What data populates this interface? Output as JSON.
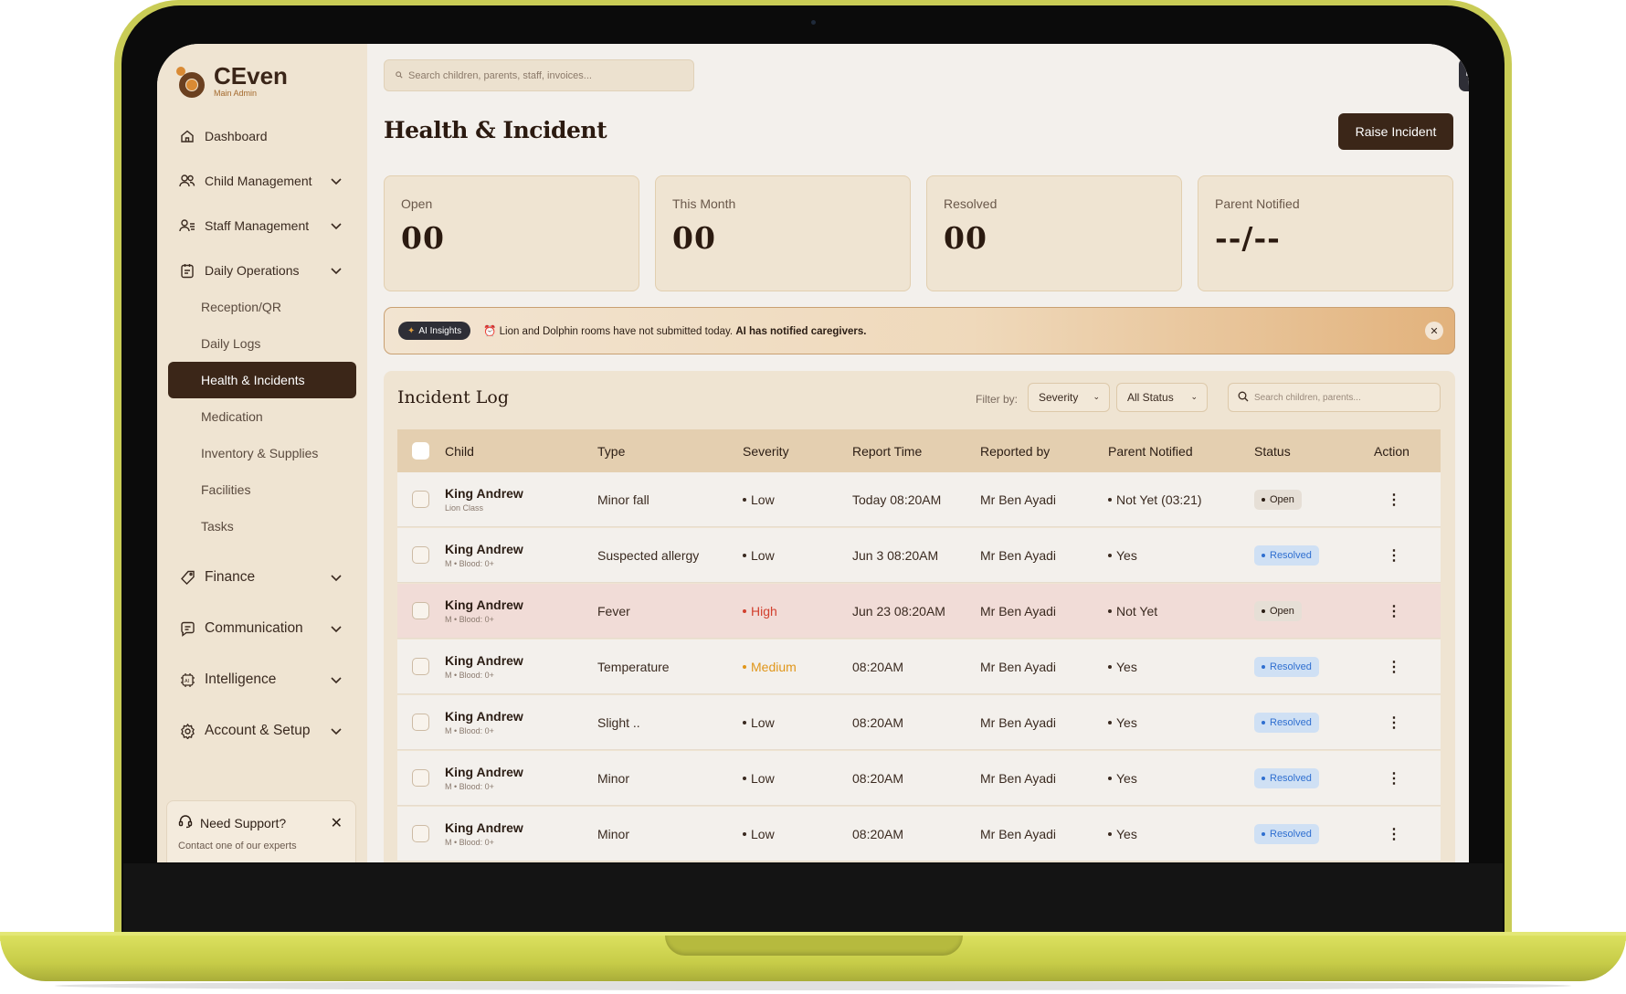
{
  "brand": {
    "name": "CEven",
    "subtitle": "Main Admin"
  },
  "search": {
    "placeholder": "Search children, parents, staff, invoices..."
  },
  "sidebar": {
    "items": [
      {
        "label": "Dashboard",
        "icon": "home-icon"
      },
      {
        "label": "Child Management",
        "icon": "users-icon"
      },
      {
        "label": "Staff Management",
        "icon": "staff-icon"
      },
      {
        "label": "Daily Operations",
        "icon": "clipboard-icon"
      },
      {
        "label": "Finance",
        "icon": "tag-icon"
      },
      {
        "label": "Communication",
        "icon": "chat-icon"
      },
      {
        "label": "Intelligence",
        "icon": "ai-chip-icon"
      },
      {
        "label": "Account & Setup",
        "icon": "settings-icon"
      }
    ],
    "sub_items": [
      "Reception/QR",
      "Daily Logs",
      "Health & Incidents",
      "Medication",
      "Inventory & Supplies",
      "Facilities",
      "Tasks"
    ],
    "active_sub": "Health & Incidents"
  },
  "support": {
    "title": "Need Support?",
    "subtitle": "Contact one of our experts",
    "close": "✕"
  },
  "header": {
    "title": "Health & Incident",
    "raise_button": "Raise Incident"
  },
  "stats": [
    {
      "label": "Open",
      "value": "00"
    },
    {
      "label": "This Month",
      "value": "00"
    },
    {
      "label": "Resolved",
      "value": "00"
    },
    {
      "label": "Parent Notified",
      "value": "--/--"
    }
  ],
  "insight": {
    "pill": "AI Insights",
    "text": "Lion and Dolphin rooms have not submitted today.",
    "bold": "AI has notified caregivers."
  },
  "incident_log": {
    "title": "Incident Log",
    "filter_label": "Filter by:",
    "severity_select": "Severity",
    "status_select": "All Status",
    "search_placeholder": "Search children, parents...",
    "columns": [
      "Child",
      "Type",
      "Severity",
      "Report Time",
      "Reported by",
      "Parent Notified",
      "Status",
      "Action"
    ],
    "rows": [
      {
        "name": "King Andrew",
        "meta": "Lion Class",
        "type": "Minor fall",
        "severity": "Low",
        "time": "Today 08:20AM",
        "by": "Mr Ben Ayadi",
        "notified": "Not Yet",
        "notified_extra": "(03:21)",
        "status": "Open"
      },
      {
        "name": "King Andrew",
        "meta": "M • Blood: 0+",
        "type": "Suspected allergy",
        "severity": "Low",
        "time": "Jun 3 08:20AM",
        "by": "Mr Ben Ayadi",
        "notified": "Yes",
        "notified_extra": "",
        "status": "Resolved"
      },
      {
        "name": "King Andrew",
        "meta": "M • Blood: 0+",
        "type": "Fever",
        "severity": "High",
        "time": "Jun 23 08:20AM",
        "by": "Mr Ben Ayadi",
        "notified": "Not Yet",
        "notified_extra": "",
        "status": "Open"
      },
      {
        "name": "King Andrew",
        "meta": "M • Blood: 0+",
        "type": "Temperature",
        "severity": "Medium",
        "time": "08:20AM",
        "by": "Mr Ben Ayadi",
        "notified": "Yes",
        "notified_extra": "",
        "status": "Resolved"
      },
      {
        "name": "King Andrew",
        "meta": "M • Blood: 0+",
        "type": "Slight ..",
        "severity": "Low",
        "time": "08:20AM",
        "by": "Mr Ben Ayadi",
        "notified": "Yes",
        "notified_extra": "",
        "status": "Resolved"
      },
      {
        "name": "King Andrew",
        "meta": "M • Blood: 0+",
        "type": "Minor",
        "severity": "Low",
        "time": "08:20AM",
        "by": "Mr Ben Ayadi",
        "notified": "Yes",
        "notified_extra": "",
        "status": "Resolved"
      },
      {
        "name": "King Andrew",
        "meta": "M • Blood: 0+",
        "type": "Minor",
        "severity": "Low",
        "time": "08:20AM",
        "by": "Mr Ben Ayadi",
        "notified": "Yes",
        "notified_extra": "",
        "status": "Resolved"
      }
    ]
  },
  "colors": {
    "accent": "#3b2618",
    "sidebar_bg": "#efe4d2",
    "high": "#d2402e",
    "medium": "#e0961a",
    "resolved": "#2f6fd0",
    "frame": "#c9cc56"
  }
}
